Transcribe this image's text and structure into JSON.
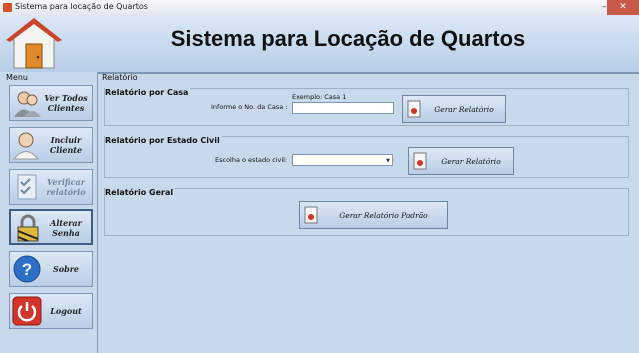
{
  "window": {
    "title": "Sistema para locação de Quartos"
  },
  "header": {
    "app_title": "Sistema para Locação de Quartos"
  },
  "menu": {
    "title": "Menu",
    "items": [
      {
        "label": "Ver Todos Clientes",
        "icon": "users-icon"
      },
      {
        "label": "Incluir Cliente",
        "icon": "person-add-icon"
      },
      {
        "label": "Verificar relatório",
        "icon": "checklist-icon"
      },
      {
        "label": "Alterar Senha",
        "icon": "padlock-icon"
      },
      {
        "label": "Sobre",
        "icon": "help-icon"
      },
      {
        "label": "Logout",
        "icon": "power-icon"
      }
    ]
  },
  "content": {
    "title": "Relatório",
    "por_casa": {
      "title": "Relatório por Casa",
      "example": "Exemplo: Casa 1",
      "label": "Informe o No. da Casa :",
      "value": "",
      "button": "Gerar Relatório"
    },
    "por_estado": {
      "title": "Relatório por Estado Civil",
      "label": "Escolha o estado civil:",
      "selected": "",
      "button": "Gerar Relatório"
    },
    "geral": {
      "title": "Relatório Geral",
      "button": "Gerar Relatório Padrão"
    }
  }
}
